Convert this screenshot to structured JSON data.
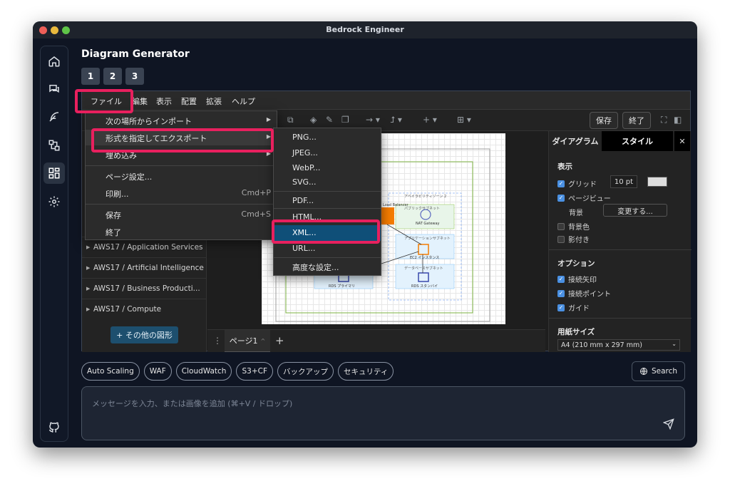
{
  "window": {
    "title": "Bedrock Engineer"
  },
  "app": {
    "title": "Diagram Generator",
    "steps": [
      "1",
      "2",
      "3"
    ]
  },
  "menubar": [
    "ファイル",
    "編集",
    "表示",
    "配置",
    "拡張",
    "ヘルプ"
  ],
  "toolbar": {
    "save": "保存",
    "close": "終了"
  },
  "file_menu": {
    "items": [
      {
        "label": "次の場所からインポート",
        "submenu": true
      },
      {
        "label": "形式を指定してエクスポート",
        "submenu": true
      },
      {
        "label": "埋め込み",
        "submenu": true
      },
      {
        "label": "ページ設定..."
      },
      {
        "label": "印刷...",
        "shortcut": "Cmd+P"
      },
      {
        "label": "保存",
        "shortcut": "Cmd+S"
      },
      {
        "label": "終了"
      }
    ]
  },
  "export_menu": {
    "items": [
      "PNG...",
      "JPEG...",
      "WebP...",
      "SVG...",
      "PDF...",
      "HTML...",
      "XML...",
      "URL...",
      "高度な設定..."
    ],
    "selected": "XML..."
  },
  "shape_categories": [
    "AWS17 / Application Services",
    "AWS17 / Artificial Intelligence",
    "AWS17 / Business Producti...",
    "AWS17 / Compute"
  ],
  "more_shapes": "+ その他の図形",
  "pages": {
    "tab": "ページ1",
    "add": "+"
  },
  "format_panel": {
    "tabs": [
      "ダイアグラム",
      "スタイル"
    ],
    "view_section": "表示",
    "grid": "グリッド",
    "grid_size": "10 pt",
    "page_view": "ページビュー",
    "background": "背景",
    "change_button": "変更する...",
    "bg_color": "背景色",
    "shadow": "影付き",
    "options_section": "オプション",
    "connection_arrows": "接続矢印",
    "connection_points": "接続ポイント",
    "guides": "ガイド",
    "paper_section": "用紙サイズ",
    "paper_value": "A4 (210 mm x 297 mm)"
  },
  "diagram": {
    "az2": "アベイラビリティゾーン 2",
    "public_subnet": "パブリックサブネット",
    "nat": "NAT Gateway",
    "lb": "Load Balancer",
    "app_subnet": "アプリケーションサブネット",
    "ec2": "EC2 インスタンス",
    "db_subnet": "データベースサブネット",
    "rds_primary": "RDS プライマリ",
    "rds_standby": "RDS スタンバイ"
  },
  "quick_chips": [
    "Auto Scaling",
    "WAF",
    "CloudWatch",
    "S3+CF",
    "バックアップ",
    "セキュリティ"
  ],
  "search_button": "Search",
  "input": {
    "placeholder": "メッセージを入力、または画像を追加 (⌘+V / ドロップ)"
  }
}
